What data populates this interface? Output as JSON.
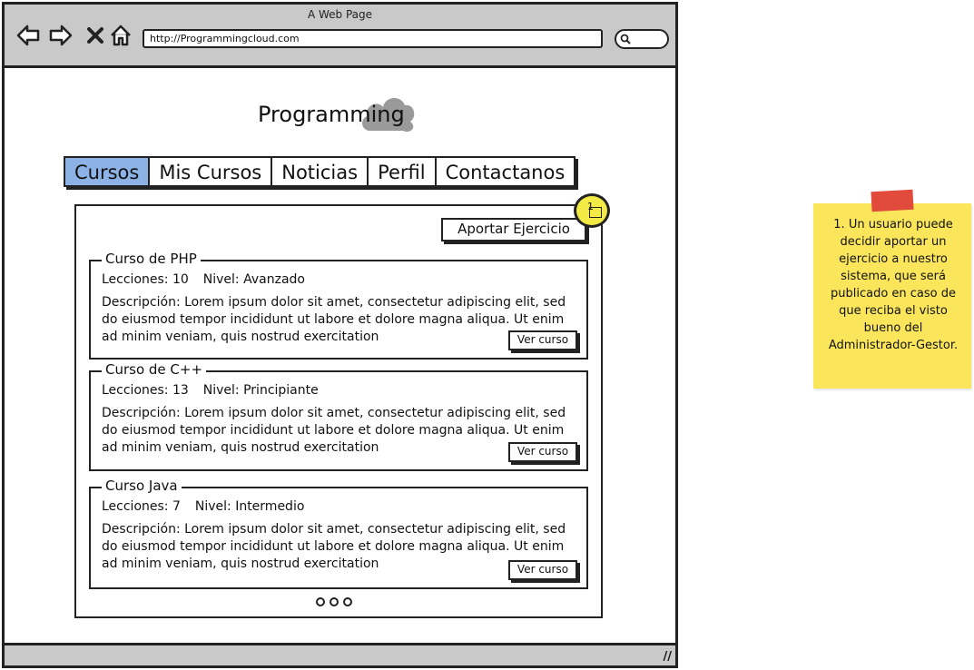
{
  "window": {
    "title": "A Web Page",
    "url": "http://Programmingcloud.com"
  },
  "nav_icons": [
    "back-arrow-icon",
    "forward-arrow-icon",
    "close-x-icon",
    "home-icon"
  ],
  "logo": {
    "text": "Programming",
    "icon": "cloud-icon",
    "cloud_color": "#9a9a9a"
  },
  "tabs": [
    {
      "label": "Cursos",
      "active": true
    },
    {
      "label": "Mis Cursos",
      "active": false
    },
    {
      "label": "Noticias",
      "active": false
    },
    {
      "label": "Perfil",
      "active": false
    },
    {
      "label": "Contactanos",
      "active": false
    }
  ],
  "colors": {
    "active_tab": "#8cb2e6",
    "chrome": "#c9c9c9",
    "sticky": "#fbe65b",
    "tape": "#e24b3b",
    "marker": "#f3ea46"
  },
  "aportar_button": "Aportar Ejercicio",
  "callout_marker": "1",
  "courses": [
    {
      "title": "Curso de PHP",
      "lecciones": "Lecciones: 10",
      "nivel": "Nivel: Avanzado",
      "descripcion": "Descripción: Lorem ipsum dolor sit amet, consectetur adipiscing elit, sed do eiusmod tempor incididunt ut labore et dolore magna aliqua. Ut enim ad minim veniam, quis nostrud exercitation",
      "button": "Ver curso"
    },
    {
      "title": "Curso de C++",
      "lecciones": "Lecciones: 13",
      "nivel": "Nivel: Principiante",
      "descripcion": "Descripción: Lorem ipsum dolor sit amet, consectetur adipiscing elit, sed do eiusmod tempor incididunt ut labore et dolore magna aliqua. Ut enim ad minim veniam, quis nostrud exercitation",
      "button": "Ver curso"
    },
    {
      "title": "Curso Java",
      "lecciones": "Lecciones: 7",
      "nivel": "Nivel: Intermedio",
      "descripcion": "Descripción: Lorem ipsum dolor sit amet, consectetur adipiscing elit, sed do eiusmod tempor incididunt ut labore et dolore magna aliqua. Ut enim ad minim veniam, quis nostrud exercitation",
      "button": "Ver curso"
    }
  ],
  "pager": {
    "dots": 3
  },
  "sticky_note": {
    "text": "1. Un usuario puede decidir aportar un ejercicio a nuestro sistema, que será publicado en caso de que reciba el visto bueno del Administrador-Gestor."
  }
}
